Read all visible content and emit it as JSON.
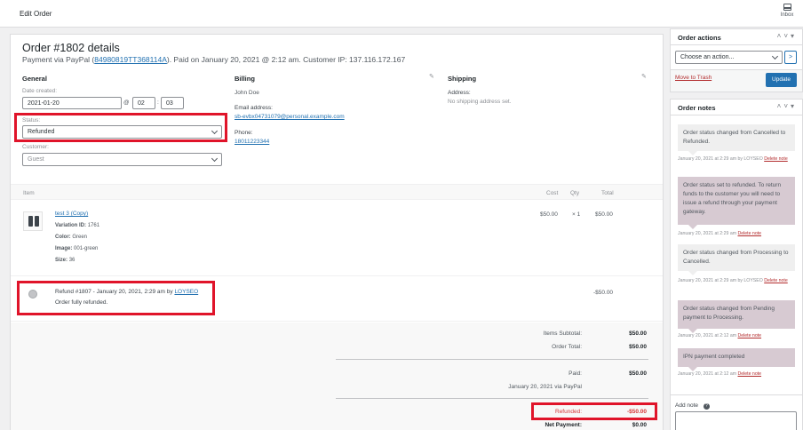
{
  "topbar": {
    "title": "Edit Order",
    "inbox_label": "Inbox"
  },
  "order": {
    "title": "Order #1802 details",
    "sub_prefix": "Payment via PayPal (",
    "transaction_id": "84980819TT368114A",
    "sub_suffix": "). Paid on January 20, 2021 @ 2:12 am. Customer IP: 137.116.172.167"
  },
  "general": {
    "heading": "General",
    "date_label": "Date created:",
    "date_value": "2021-01-20",
    "at_symbol": "@",
    "hour": "02",
    "minute": "03",
    "colon": ":",
    "status_label": "Status:",
    "status_value": "Refunded",
    "customer_label": "Customer:",
    "customer_value": "Guest"
  },
  "billing": {
    "heading": "Billing",
    "name": "John Doe",
    "email_label": "Email address:",
    "email_value": "sb-evbx04731079@personal.example.com",
    "phone_label": "Phone:",
    "phone_value": "18011223344"
  },
  "shipping": {
    "heading": "Shipping",
    "address_label": "Address:",
    "address_value": "No shipping address set."
  },
  "items": {
    "col_item": "Item",
    "col_cost": "Cost",
    "col_qty": "Qty",
    "col_total": "Total",
    "product": {
      "name": "test 3 (Copy)",
      "variation_label": "Variation ID:",
      "variation_value": "1761",
      "color_label": "Color:",
      "color_value": "Green",
      "image_label": "Image:",
      "image_value": "001-green",
      "size_label": "Size:",
      "size_value": "36",
      "cost": "$50.00",
      "qty": "× 1",
      "total": "$50.00"
    },
    "refund": {
      "text_prefix": "Refund #1807 - January 20, 2021, 2:29 am by",
      "author": "LOYSEO",
      "reason": "Order fully refunded.",
      "amount": "-$50.00"
    }
  },
  "totals": {
    "subtotal_label": "Items Subtotal:",
    "subtotal_value": "$50.00",
    "order_total_label": "Order Total:",
    "order_total_value": "$50.00",
    "paid_label": "Paid:",
    "paid_value": "$50.00",
    "paid_note": "January 20, 2021 via PayPal",
    "refunded_label": "Refunded:",
    "refunded_value": "-$50.00",
    "net_label": "Net Payment:",
    "net_value": "$0.00"
  },
  "order_actions": {
    "heading": "Order actions",
    "select_placeholder": "Choose an action...",
    "go_label": ">",
    "trash_label": "Move to Trash",
    "update_label": "Update"
  },
  "order_notes": {
    "heading": "Order notes",
    "delete_label": "Delete note",
    "notes": [
      {
        "text": "Order status changed from Cancelled to Refunded.",
        "meta": "January 20, 2021 at 2:29 am by LOYSEO"
      },
      {
        "text": "Order status set to refunded. To return funds to the customer you will need to issue a refund through your payment gateway.",
        "meta": "January 20, 2021 at 2:29 am"
      },
      {
        "text": "Order status changed from Processing to Cancelled.",
        "meta": "January 20, 2021 at 2:29 am by LOYSEO"
      },
      {
        "text": "Order status changed from Pending payment to Processing.",
        "meta": "January 20, 2021 at 2:12 am"
      },
      {
        "text": "IPN payment completed",
        "meta": "January 20, 2021 at 2:12 am"
      }
    ],
    "add_note_label": "Add note",
    "help_icon": "?"
  },
  "colors": {
    "accent": "#2271b1",
    "highlight": "#e0142a",
    "note_system": "#d7cad2",
    "note_private": "#efefef"
  }
}
